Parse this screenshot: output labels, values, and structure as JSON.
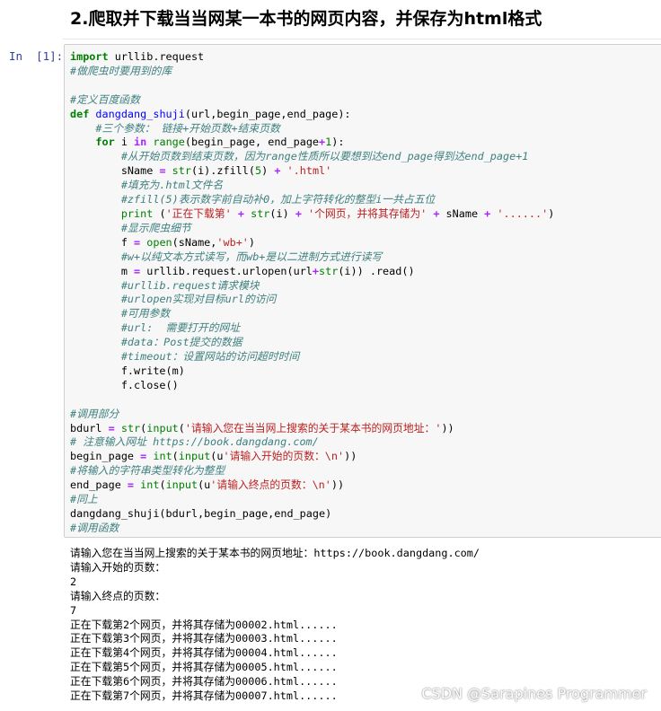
{
  "heading": "2.爬取并下载当当网某一本书的网页内容，并保存为html格式",
  "cell": {
    "prompt": "In  [1]:",
    "lines": [
      [
        {
          "t": "import",
          "c": "kw"
        },
        {
          "t": " urllib.request",
          "c": ""
        }
      ],
      [
        {
          "t": "#做爬虫时要用到的库",
          "c": "cm"
        }
      ],
      [],
      [
        {
          "t": "#定义百度函数",
          "c": "cm"
        }
      ],
      [
        {
          "t": "def",
          "c": "kw"
        },
        {
          "t": " ",
          "c": ""
        },
        {
          "t": "dangdang_shuji",
          "c": "fn"
        },
        {
          "t": "(url,begin_page,end_page):",
          "c": ""
        }
      ],
      [
        {
          "t": "    ",
          "c": ""
        },
        {
          "t": "#三个参数： 链接+开始页数+结束页数",
          "c": "cm"
        }
      ],
      [
        {
          "t": "    ",
          "c": ""
        },
        {
          "t": "for",
          "c": "kw"
        },
        {
          "t": " i ",
          "c": ""
        },
        {
          "t": "in",
          "c": "op"
        },
        {
          "t": " ",
          "c": ""
        },
        {
          "t": "range",
          "c": "bi"
        },
        {
          "t": "(begin_page, end_page",
          "c": ""
        },
        {
          "t": "+",
          "c": "op"
        },
        {
          "t": "1",
          "c": "nm"
        },
        {
          "t": "):",
          "c": ""
        }
      ],
      [
        {
          "t": "        ",
          "c": ""
        },
        {
          "t": "#从开始页数到结束页数，因为range性质所以要想到达end_page得到达end_page+1",
          "c": "cm"
        }
      ],
      [
        {
          "t": "        sName ",
          "c": ""
        },
        {
          "t": "=",
          "c": "op"
        },
        {
          "t": " ",
          "c": ""
        },
        {
          "t": "str",
          "c": "bi"
        },
        {
          "t": "(i).zfill(",
          "c": ""
        },
        {
          "t": "5",
          "c": "nm"
        },
        {
          "t": ") ",
          "c": ""
        },
        {
          "t": "+",
          "c": "op"
        },
        {
          "t": " ",
          "c": ""
        },
        {
          "t": "'.html'",
          "c": "st"
        }
      ],
      [
        {
          "t": "        ",
          "c": ""
        },
        {
          "t": "#填充为.html文件名",
          "c": "cm"
        }
      ],
      [
        {
          "t": "        ",
          "c": ""
        },
        {
          "t": "#zfill(5)表示数字前自动补0，加上字符转化的整型i一共占五位",
          "c": "cm"
        }
      ],
      [
        {
          "t": "        ",
          "c": ""
        },
        {
          "t": "print",
          "c": "bi"
        },
        {
          "t": " (",
          "c": ""
        },
        {
          "t": "'正在下载第'",
          "c": "st"
        },
        {
          "t": " ",
          "c": ""
        },
        {
          "t": "+",
          "c": "op"
        },
        {
          "t": " ",
          "c": ""
        },
        {
          "t": "str",
          "c": "bi"
        },
        {
          "t": "(i) ",
          "c": ""
        },
        {
          "t": "+",
          "c": "op"
        },
        {
          "t": " ",
          "c": ""
        },
        {
          "t": "'个网页，并将其存储为'",
          "c": "st"
        },
        {
          "t": " ",
          "c": ""
        },
        {
          "t": "+",
          "c": "op"
        },
        {
          "t": " sName ",
          "c": ""
        },
        {
          "t": "+",
          "c": "op"
        },
        {
          "t": " ",
          "c": ""
        },
        {
          "t": "'......'",
          "c": "st"
        },
        {
          "t": ")",
          "c": ""
        }
      ],
      [
        {
          "t": "        ",
          "c": ""
        },
        {
          "t": "#显示爬虫细节",
          "c": "cm"
        }
      ],
      [
        {
          "t": "        f ",
          "c": ""
        },
        {
          "t": "=",
          "c": "op"
        },
        {
          "t": " ",
          "c": ""
        },
        {
          "t": "open",
          "c": "bi"
        },
        {
          "t": "(sName,",
          "c": ""
        },
        {
          "t": "'wb+'",
          "c": "st"
        },
        {
          "t": ")",
          "c": ""
        }
      ],
      [
        {
          "t": "        ",
          "c": ""
        },
        {
          "t": "#w+以纯文本方式读写，而wb+是以二进制方式进行读写",
          "c": "cm"
        }
      ],
      [
        {
          "t": "        m ",
          "c": ""
        },
        {
          "t": "=",
          "c": "op"
        },
        {
          "t": " urllib.request.urlopen(url",
          "c": ""
        },
        {
          "t": "+",
          "c": "op"
        },
        {
          "t": "str",
          "c": "bi"
        },
        {
          "t": "(i)) .read()",
          "c": ""
        }
      ],
      [
        {
          "t": "        ",
          "c": ""
        },
        {
          "t": "#urllib.request请求模块",
          "c": "cm"
        }
      ],
      [
        {
          "t": "        ",
          "c": ""
        },
        {
          "t": "#urlopen实现对目标url的访问",
          "c": "cm"
        }
      ],
      [
        {
          "t": "        ",
          "c": ""
        },
        {
          "t": "#可用参数",
          "c": "cm"
        }
      ],
      [
        {
          "t": "        ",
          "c": ""
        },
        {
          "t": "#url:  需要打开的网址",
          "c": "cm"
        }
      ],
      [
        {
          "t": "        ",
          "c": ""
        },
        {
          "t": "#data：Post提交的数据",
          "c": "cm"
        }
      ],
      [
        {
          "t": "        ",
          "c": ""
        },
        {
          "t": "#timeout：设置网站的访问超时时间",
          "c": "cm"
        }
      ],
      [
        {
          "t": "        f.write(m)",
          "c": ""
        }
      ],
      [
        {
          "t": "        f.close()",
          "c": ""
        }
      ],
      [],
      [
        {
          "t": "#调用部分",
          "c": "cm"
        }
      ],
      [
        {
          "t": "bdurl ",
          "c": ""
        },
        {
          "t": "=",
          "c": "op"
        },
        {
          "t": " ",
          "c": ""
        },
        {
          "t": "str",
          "c": "bi"
        },
        {
          "t": "(",
          "c": ""
        },
        {
          "t": "input",
          "c": "bi"
        },
        {
          "t": "(",
          "c": ""
        },
        {
          "t": "'请输入您在当当网上搜索的关于某本书的网页地址：'",
          "c": "st"
        },
        {
          "t": "))",
          "c": ""
        }
      ],
      [
        {
          "t": "# 注意输入网址 https://book.dangdang.com/",
          "c": "cm"
        }
      ],
      [
        {
          "t": "begin_page ",
          "c": ""
        },
        {
          "t": "=",
          "c": "op"
        },
        {
          "t": " ",
          "c": ""
        },
        {
          "t": "int",
          "c": "bi"
        },
        {
          "t": "(",
          "c": ""
        },
        {
          "t": "input",
          "c": "bi"
        },
        {
          "t": "(u",
          "c": ""
        },
        {
          "t": "'请输入开始的页数：\\n'",
          "c": "st"
        },
        {
          "t": "))",
          "c": ""
        }
      ],
      [
        {
          "t": "#将输入的字符串类型转化为整型",
          "c": "cm"
        }
      ],
      [
        {
          "t": "end_page ",
          "c": ""
        },
        {
          "t": "=",
          "c": "op"
        },
        {
          "t": " ",
          "c": ""
        },
        {
          "t": "int",
          "c": "bi"
        },
        {
          "t": "(",
          "c": ""
        },
        {
          "t": "input",
          "c": "bi"
        },
        {
          "t": "(u",
          "c": ""
        },
        {
          "t": "'请输入终点的页数：\\n'",
          "c": "st"
        },
        {
          "t": "))",
          "c": ""
        }
      ],
      [
        {
          "t": "#同上",
          "c": "cm"
        }
      ],
      [
        {
          "t": "dangdang_shuji(bdurl,begin_page,end_page)",
          "c": ""
        }
      ],
      [
        {
          "t": "#调用函数",
          "c": "cm"
        }
      ]
    ]
  },
  "output": [
    "请输入您在当当网上搜索的关于某本书的网页地址：https://book.dangdang.com/",
    "请输入开始的页数：",
    "2",
    "请输入终点的页数：",
    "7",
    "正在下载第2个网页，并将其存储为00002.html......",
    "正在下载第3个网页，并将其存储为00003.html......",
    "正在下载第4个网页，并将其存储为00004.html......",
    "正在下载第5个网页，并将其存储为00005.html......",
    "正在下载第6个网页，并将其存储为00006.html......",
    "正在下载第7个网页，并将其存储为00007.html......"
  ],
  "watermark": "CSDN @Sarapines Programmer"
}
